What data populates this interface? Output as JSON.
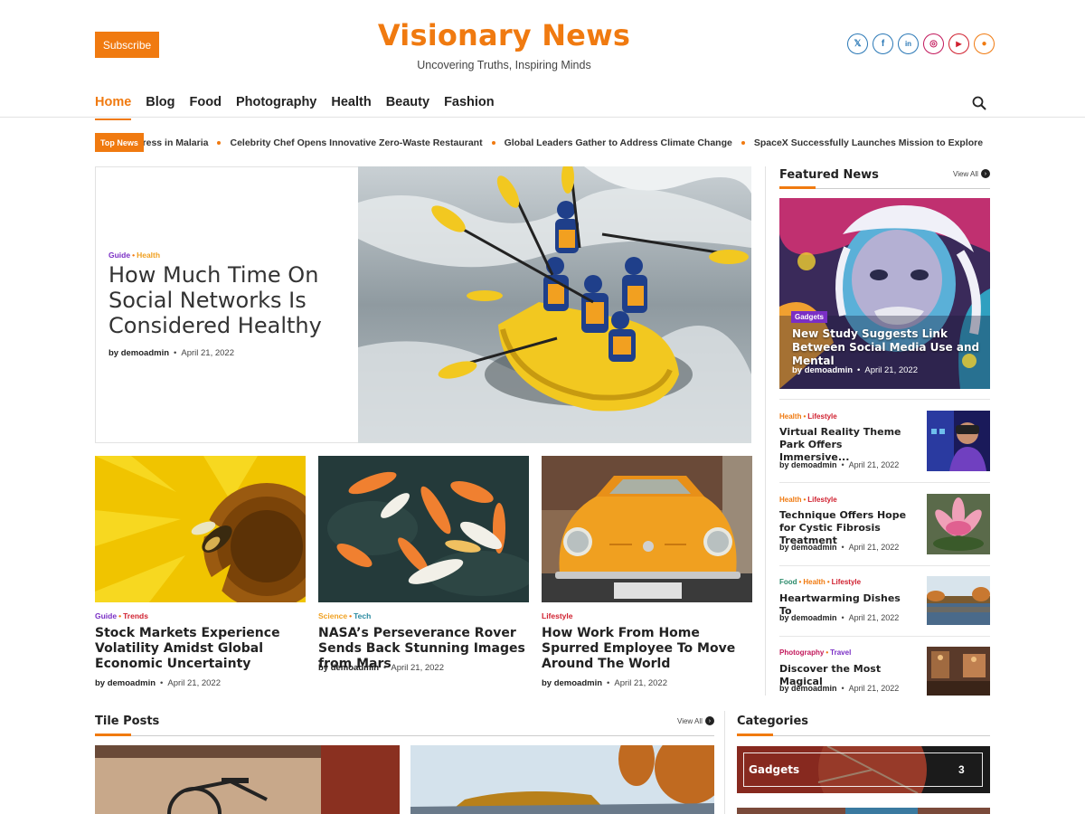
{
  "header": {
    "subscribe_label": "Subscribe",
    "site_title": "Visionary News",
    "tagline": "Uncovering Truths, Inspiring Minds",
    "social": [
      {
        "name": "x-icon",
        "glyph": "𝕏",
        "color": "#2a78b6"
      },
      {
        "name": "facebook-icon",
        "glyph": "f",
        "color": "#2a78b6"
      },
      {
        "name": "linkedin-icon",
        "glyph": "in",
        "color": "#2a78b6"
      },
      {
        "name": "instagram-icon",
        "glyph": "◎",
        "color": "#c2185b"
      },
      {
        "name": "youtube-icon",
        "glyph": "▶",
        "color": "#d0202f"
      },
      {
        "name": "reddit-icon",
        "glyph": "●",
        "color": "#f07a10"
      }
    ]
  },
  "nav": {
    "items": [
      "Home",
      "Blog",
      "Food",
      "Photography",
      "Health",
      "Beauty",
      "Fashion"
    ],
    "active_index": 0
  },
  "ticker": {
    "label": "Top News",
    "items": [
      "Malaria Vaccine Announces Major Progress in Malaria",
      "Celebrity Chef Opens Innovative Zero-Waste Restaurant",
      "Global Leaders Gather to Address Climate Change",
      "SpaceX Successfully Launches Mission to Explore"
    ]
  },
  "hero": {
    "cat1": "Guide",
    "cat2": "Health",
    "title": "How Much Time On Social Networks Is Considered Healthy",
    "author": "by demoadmin",
    "date": "April 21, 2022"
  },
  "cards": [
    {
      "cat1": "Guide",
      "cat2": "Trends",
      "title": "Stock Markets Experience Volatility Amidst Global Economic Uncertainty",
      "author": "by demoadmin",
      "date": "April 21, 2022"
    },
    {
      "cat1": "Science",
      "cat2": "Tech",
      "title": "NASA’s Perseverance Rover Sends Back Stunning Images from Mars",
      "author": "by demoadmin",
      "date": "April 21, 2022"
    },
    {
      "cat1": "Lifestyle",
      "title": "How Work From Home Spurred Employee To Move Around The World",
      "author": "by demoadmin",
      "date": "April 21, 2022"
    }
  ],
  "sidebar": {
    "title": "Featured News",
    "view_all": "View All",
    "featured": {
      "badge": "Gadgets",
      "title": "New Study Suggests Link Between Social Media Use and Mental",
      "author": "by demoadmin",
      "date": "April 21, 2022"
    },
    "items": [
      {
        "cats": [
          "Health",
          "Lifestyle"
        ],
        "title": "Virtual Reality Theme Park Offers Immersive...",
        "author": "by demoadmin",
        "date": "April 21, 2022"
      },
      {
        "cats": [
          "Health",
          "Lifestyle"
        ],
        "title": "Technique Offers Hope for Cystic Fibrosis Treatment",
        "author": "by demoadmin",
        "date": "April 21, 2022"
      },
      {
        "cats": [
          "Food",
          "Health",
          "Lifestyle"
        ],
        "title": "Heartwarming Dishes To",
        "author": "by demoadmin",
        "date": "April 21, 2022"
      },
      {
        "cats": [
          "Photography",
          "Travel"
        ],
        "title": "Discover the Most Magical",
        "author": "by demoadmin",
        "date": "April 21, 2022"
      }
    ]
  },
  "tile_posts": {
    "title": "Tile Posts",
    "view_all": "View All"
  },
  "categories": {
    "title": "Categories",
    "items": [
      {
        "name": "Gadgets",
        "count": "3"
      }
    ]
  },
  "colors": {
    "accent": "#f07a10",
    "purple": "#7a2fc5"
  }
}
